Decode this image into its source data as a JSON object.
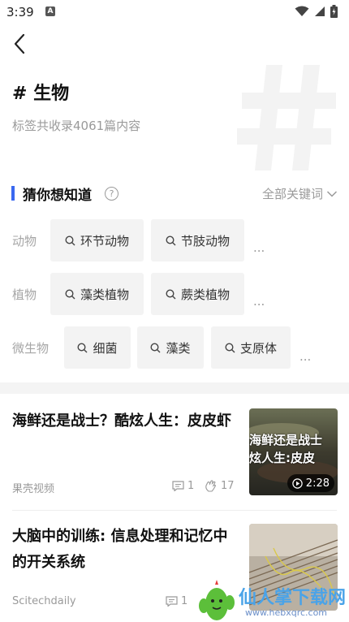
{
  "status": {
    "time": "3:39",
    "notif_letter": "A"
  },
  "tag": {
    "title": "# 生物",
    "subtitle": "标签共收录4061篇内容"
  },
  "section": {
    "title": "猜你想知道",
    "help": "?",
    "all_keywords": "全部关键词"
  },
  "keyword_rows": [
    {
      "category": "动物",
      "chips": [
        "环节动物",
        "节肢动物"
      ],
      "more": "..."
    },
    {
      "category": "植物",
      "chips": [
        "藻类植物",
        "蕨类植物"
      ],
      "more": "..."
    },
    {
      "category": "微生物",
      "chips": [
        "细菌",
        "藻类",
        "支原体"
      ],
      "more": "..."
    }
  ],
  "articles": [
    {
      "title": "海鲜还是战士？酷炫人生：皮皮虾",
      "source": "果壳视频",
      "comments": "1",
      "likes": "17",
      "thumb_text_1": "海鲜还是战士",
      "thumb_text_2": "炫人生:皮皮",
      "duration": "2:28"
    },
    {
      "title": "大脑中的训练: 信息处理和记忆中的开关系统",
      "source": "Scitechdaily",
      "comments": "1"
    }
  ],
  "watermark": {
    "text": "仙人掌下载网",
    "url": "www.hebxqrc.com"
  },
  "colors": {
    "accent": "#3a68f0",
    "muted": "#9a9a9a",
    "chip_bg": "#f3f3f3"
  }
}
